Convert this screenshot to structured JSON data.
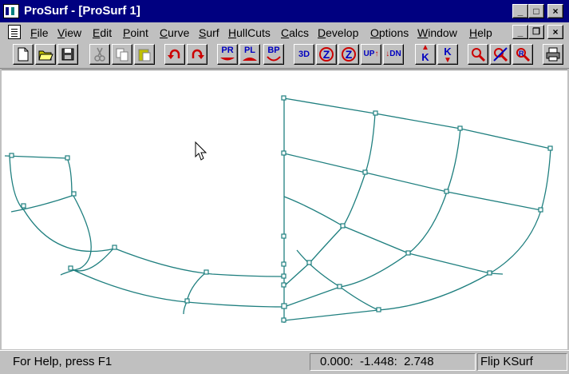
{
  "window": {
    "title": "ProSurf - [ProSurf 1]",
    "controls": {
      "minimize": "_",
      "maximize": "□",
      "close": "×"
    },
    "doc_controls": {
      "minimize": "_",
      "restore": "❐",
      "close": "×"
    }
  },
  "menu": [
    "File",
    "View",
    "Edit",
    "Point",
    "Curve",
    "Surf",
    "HullCuts",
    "Calcs",
    "Develop",
    "Options",
    "Window",
    "Help"
  ],
  "toolbar": {
    "new": "new-file-icon",
    "open": "open-folder-icon",
    "save": "save-disk-icon",
    "cut": "scissors-icon",
    "copy": "copy-icon",
    "paste": "paste-icon",
    "undo": "undo-icon",
    "redo": "redo-icon",
    "pr_label": "PR",
    "pl_label": "PL",
    "bp_label": "BP",
    "view3d_label": "3D",
    "rot_label": "Z",
    "up_label": "UP",
    "dn_label": "DN",
    "k_label": "K",
    "zoom": "zoom-icon",
    "zoom_x": "zoom-cancel-icon",
    "zoom_r": "zoom-redraw-icon",
    "print": "printer-icon",
    "colors": {
      "red": "#cc0000",
      "blue": "#0000c0",
      "teal": "#008080"
    }
  },
  "status": {
    "help": "For Help, press F1",
    "coords": "0.000:  -1.448:  2.748",
    "mode": "Flip KSurf"
  },
  "drawing": {
    "line_color": "#1f7f7f"
  }
}
